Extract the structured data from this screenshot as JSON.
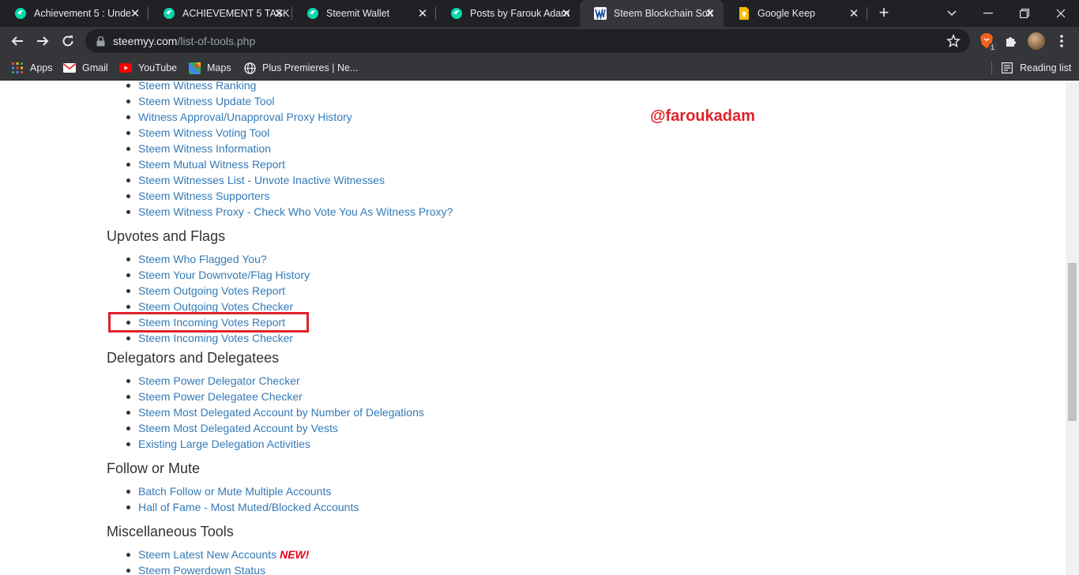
{
  "browser": {
    "tabs": [
      {
        "title": "Achievement 5 : Unde",
        "icon": "steemit-icon",
        "active": false
      },
      {
        "title": "ACHIEVEMENT 5 TASK",
        "icon": "steemit-icon",
        "active": false
      },
      {
        "title": "Steemit Wallet",
        "icon": "steemit-icon",
        "active": false
      },
      {
        "title": "Posts by Farouk Adam",
        "icon": "steemit-icon",
        "active": false
      },
      {
        "title": "Steem Blockchain Soft",
        "icon": "steemyy-icon",
        "active": true
      },
      {
        "title": "Google Keep",
        "icon": "google-keep-icon",
        "active": false
      }
    ],
    "url_host": "steemyy.com",
    "url_path": "/list-of-tools.php",
    "extension_badge": "1",
    "bookmarks": [
      {
        "label": "Apps",
        "icon": "apps-grid-icon"
      },
      {
        "label": "Gmail",
        "icon": "gmail-icon"
      },
      {
        "label": "YouTube",
        "icon": "youtube-icon"
      },
      {
        "label": "Maps",
        "icon": "maps-icon"
      },
      {
        "label": "Plus Premieres | Ne...",
        "icon": "globe-icon"
      }
    ],
    "reading_list": "Reading list"
  },
  "page": {
    "witness_links": [
      "Steem Witness Ranking",
      "Steem Witness Update Tool",
      "Witness Approval/Unapproval Proxy History",
      "Steem Witness Voting Tool",
      "Steem Witness Information",
      "Steem Mutual Witness Report",
      "Steem Witnesses List - Unvote Inactive Witnesses",
      "Steem Witness Supporters",
      "Steem Witness Proxy - Check Who Vote You As Witness Proxy?"
    ],
    "sections": [
      {
        "heading": "Upvotes and Flags",
        "links": [
          "Steem Who Flagged You?",
          "Steem Your Downvote/Flag History",
          "Steem Outgoing Votes Report",
          "Steem Outgoing Votes Checker",
          "Steem Incoming Votes Report",
          "Steem Incoming Votes Checker"
        ]
      },
      {
        "heading": "Delegators and Delegatees",
        "links": [
          "Steem Power Delegator Checker",
          "Steem Power Delegatee Checker",
          "Steem Most Delegated Account by Number of Delegations",
          "Steem Most Delegated Account by Vests",
          "Existing Large Delegation Activities"
        ]
      },
      {
        "heading": "Follow or Mute",
        "links": [
          "Batch Follow or Mute Multiple Accounts",
          "Hall of Fame - Most Muted/Blocked Accounts"
        ]
      },
      {
        "heading": "Miscellaneous Tools",
        "links": [
          "Steem Latest New Accounts",
          "Steem Powerdown Status"
        ]
      }
    ],
    "new_badge": "NEW!",
    "watermark": "@faroukadam",
    "highlighted_link": "Steem Incoming Votes Report"
  },
  "colors": {
    "link": "#337ab7",
    "annotation_red": "#e0222a",
    "tabstrip_bg": "#202124",
    "toolbar_bg": "#35363a"
  }
}
